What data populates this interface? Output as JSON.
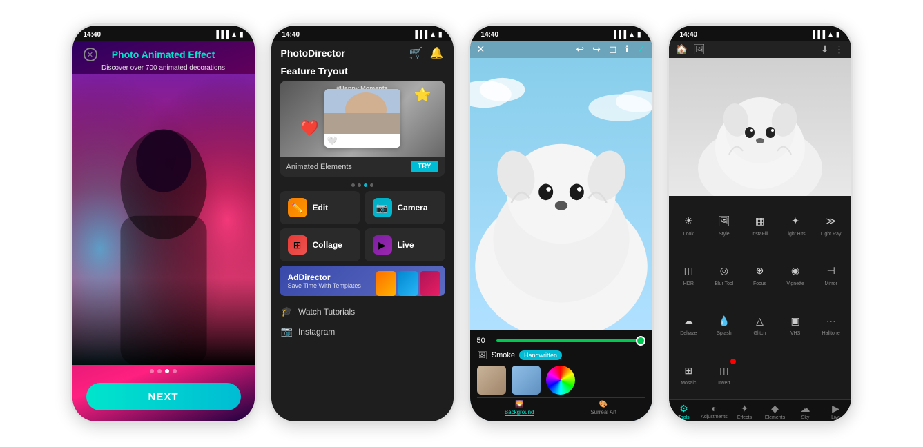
{
  "phone1": {
    "status_time": "14:40",
    "title": "Photo Animated Effect",
    "subtitle": "Discover over 700 animated decorations",
    "next_btn": "NEXT"
  },
  "phone2": {
    "status_time": "14:40",
    "logo": "PhotoDirector",
    "section": "Feature Tryout",
    "feature_label": "Animated Elements",
    "try_btn": "TRY",
    "menu": [
      {
        "label": "Edit",
        "icon": "✏️"
      },
      {
        "label": "Camera",
        "icon": "📷"
      },
      {
        "label": "Collage",
        "icon": "⊞"
      },
      {
        "label": "Live",
        "icon": "▶"
      }
    ],
    "ad_title": "AdDirector",
    "ad_subtitle": "Save Time With Templates",
    "watch": "Watch Tutorials",
    "instagram": "Instagram"
  },
  "phone3": {
    "status_time": "14:40",
    "slider_value": "50",
    "smoke_label": "Smoke",
    "handwritten": "Handwritten",
    "tab_background": "Background",
    "tab_surreal": "Surreal Art"
  },
  "phone4": {
    "status_time": "14:40",
    "tools": [
      {
        "label": "Look",
        "icon": "☀"
      },
      {
        "label": "Style",
        "icon": "🖼"
      },
      {
        "label": "InstaFill",
        "icon": "▦"
      },
      {
        "label": "Light Hits",
        "icon": "✦"
      },
      {
        "label": "Light Ray",
        "icon": "≫"
      },
      {
        "label": "HDR",
        "icon": "◫"
      },
      {
        "label": "Blur Tool",
        "icon": "◎"
      },
      {
        "label": "Focus",
        "icon": "⊕"
      },
      {
        "label": "Vignette",
        "icon": "◉"
      },
      {
        "label": "Mirror",
        "icon": "⊣"
      },
      {
        "label": "Dehaze",
        "icon": "☁"
      },
      {
        "label": "Splash",
        "icon": "💧"
      },
      {
        "label": "Glitch",
        "icon": "△"
      },
      {
        "label": "VHS",
        "icon": "▣"
      },
      {
        "label": "Halftone",
        "icon": "⋯"
      },
      {
        "label": "Mosaic",
        "icon": "⊞"
      },
      {
        "label": "Invert",
        "icon": "◫"
      }
    ],
    "bottom_tabs": [
      {
        "label": "Tools"
      },
      {
        "label": "Adjustments"
      },
      {
        "label": "Effects"
      },
      {
        "label": "Elements"
      },
      {
        "label": "Sky"
      },
      {
        "label": "Live"
      }
    ]
  }
}
